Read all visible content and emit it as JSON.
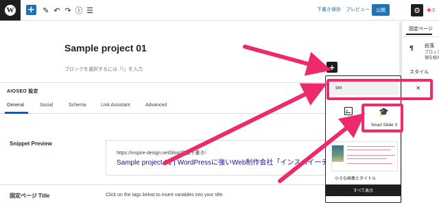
{
  "toolbar": {
    "wp_logo": "W",
    "add_block": "+",
    "icons": [
      "pencil-icon",
      "undo-icon",
      "redo-icon",
      "info-icon",
      "list-view-icon"
    ],
    "icon_glyphs": [
      "✎",
      "↶",
      "↷",
      "ⓘ",
      "☰"
    ],
    "save_draft": "下書き保存",
    "preview": "プレビュー",
    "publish": "公開",
    "settings_glyph": "⚙",
    "aioseo_count": "3",
    "accent_color": "#2271b1"
  },
  "editor": {
    "post_title": "Sample project 01",
    "block_placeholder": "ブロックを選択するには「/」を入力",
    "inline_inserter": "+"
  },
  "aioseo": {
    "title": "AIOSEO 設定",
    "tabs": [
      "General",
      "Social",
      "Schema",
      "Link Assistant",
      "Advanced"
    ],
    "active_tab": "General",
    "snippet_label": "Snippet Preview",
    "snippet_url": "https://inspire-design.net/blog/自動下書き/",
    "snippet_title": "Sample project 01 | WordPressに強いWeb制作会社「インスパイ一デザ",
    "page_title_label": "固定ページ Title",
    "tags_hint": "Click on the tags below to insert variables into your title."
  },
  "inserter": {
    "search_value": "sm",
    "clear_glyph": "×",
    "results": [
      {
        "label": "",
        "icon": "image-icon"
      },
      {
        "label": "Smart Slider 3",
        "icon": "graduation-cap-icon",
        "glyph": "🎓"
      }
    ],
    "pattern_label": "小さな画像とタイトル",
    "browse_all": "すべて表示"
  },
  "sidebar": {
    "tab": "固定ページ",
    "block_icon": "¶",
    "block_name": "段落",
    "block_desc_1": "ブロック",
    "block_desc_2": "価を組み",
    "style_heading": "スタイル"
  },
  "annotation": {
    "color": "#ee2a6c"
  }
}
